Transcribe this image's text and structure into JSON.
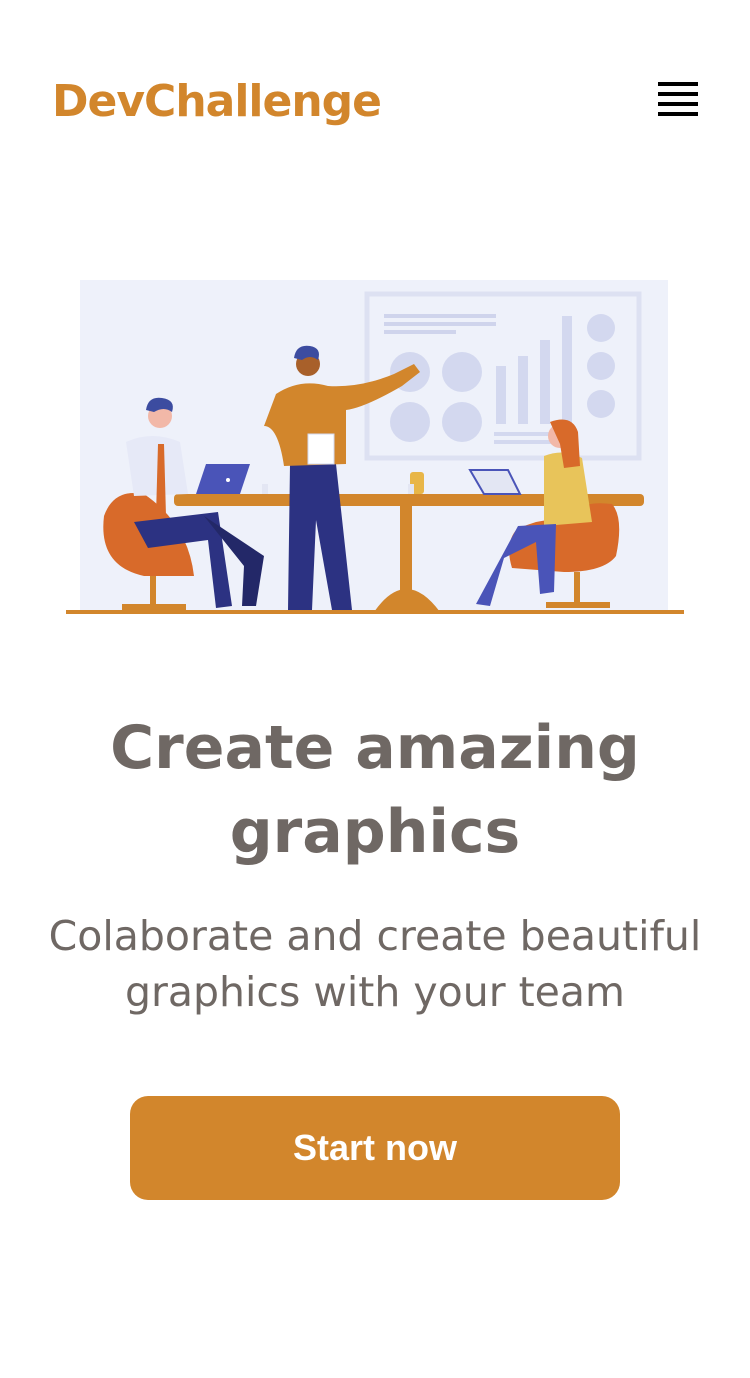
{
  "brand": {
    "name": "DevChallenge"
  },
  "header": {
    "menu_icon": "hamburger-menu-icon"
  },
  "hero": {
    "illustration": "team-meeting-illustration",
    "title": "Create amazing graphics",
    "subtitle": "Colaborate and create beautiful graphics with your team",
    "cta_label": "Start now"
  },
  "colors": {
    "accent": "#d2862c",
    "text": "#6f6864",
    "background": "#ffffff",
    "illustration_panel": "#eef1fa",
    "illustration_chart": "#d3d8ef",
    "navy": "#2c3282",
    "orange_chair": "#d86a2a"
  }
}
